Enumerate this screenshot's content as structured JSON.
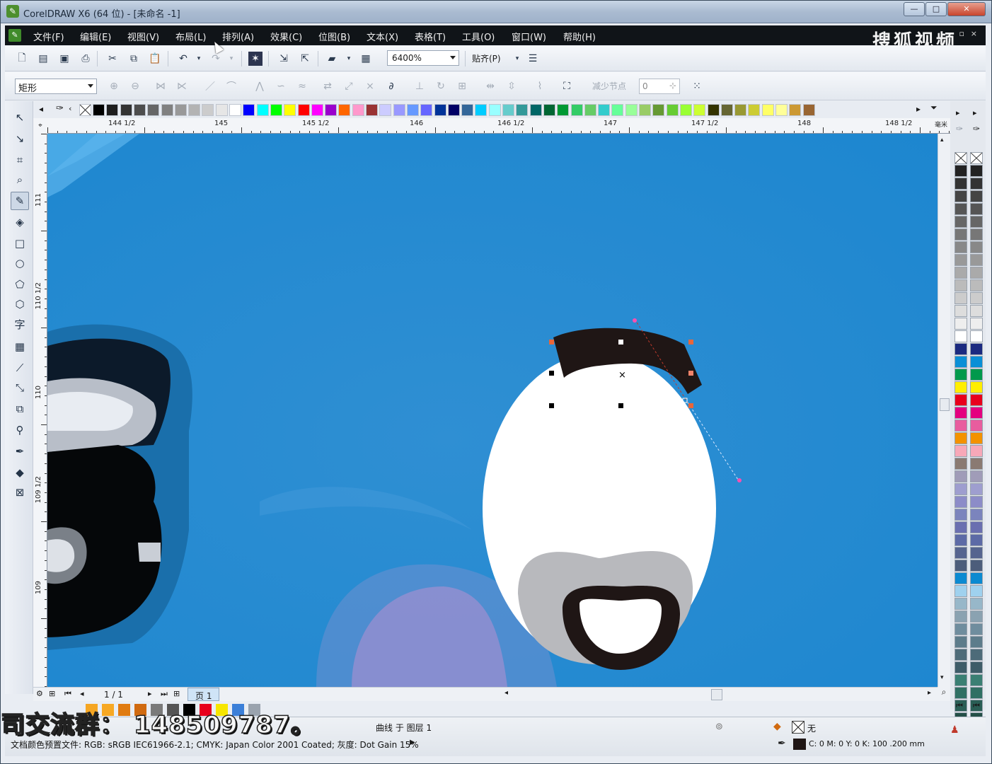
{
  "window": {
    "title": "CorelDRAW X6 (64 位) - [未命名 -1]",
    "minimize": "—",
    "maximize": "□",
    "close": "✕"
  },
  "menu": {
    "items": [
      "文件(F)",
      "编辑(E)",
      "视图(V)",
      "布局(L)",
      "排列(A)",
      "效果(C)",
      "位图(B)",
      "文本(X)",
      "表格(T)",
      "工具(O)",
      "窗口(W)",
      "帮助(H)"
    ],
    "watermark": "搜狐视频"
  },
  "standard_toolbar": {
    "zoom_value": "6400%",
    "snap_label": "贴齐(P)"
  },
  "property_bar": {
    "shape_select_value": "矩形",
    "reduce_nodes_label": "减少节点",
    "reduce_nodes_value": "0"
  },
  "palette_colors": [
    "#000000",
    "#1e1e1e",
    "#333333",
    "#4d4d4d",
    "#666666",
    "#808080",
    "#999999",
    "#b3b3b3",
    "#cccccc",
    "#e6e6e6",
    "#ffffff",
    "#0000ff",
    "#00ffff",
    "#00ff00",
    "#ffff00",
    "#ff0000",
    "#ff00ff",
    "#9900cc",
    "#ff6600",
    "#ff99cc",
    "#993333",
    "#ccccff",
    "#9999ff",
    "#6699ff",
    "#6666ff",
    "#003399",
    "#000066",
    "#336699",
    "#00ccff",
    "#99ffff",
    "#66cccc",
    "#339999",
    "#006666",
    "#006633",
    "#009933",
    "#33cc66",
    "#66cc66",
    "#33cccc",
    "#66ff99",
    "#99ff99",
    "#99cc66",
    "#669933",
    "#66cc33",
    "#99ff33",
    "#ccff33",
    "#333300",
    "#666633",
    "#999933",
    "#cccc33",
    "#ffff66",
    "#ffff99",
    "#cc9933",
    "#996633"
  ],
  "ruler": {
    "h_labels": [
      "144  1/2",
      "145",
      "145  1/2",
      "146",
      "146  1/2",
      "147",
      "147  1/2",
      "148",
      "148  1/2"
    ],
    "v_labels": [
      "111",
      "110  1/2",
      "110",
      "109  1/2",
      "109"
    ],
    "unit": "毫米"
  },
  "page_nav": {
    "counter": "1 / 1",
    "page_tab": "页 1"
  },
  "status": {
    "object_info": "曲线 于 图层 1",
    "fill_none": "无",
    "color_profile": "文档颜色预置文件: RGB: sRGB IEC61966-2.1; CMYK: Japan Color 2001 Coated; 灰度: Dot Gain 15%",
    "outline_info": "C: 0 M: 0 Y: 0 K: 100  .200 mm"
  },
  "overlay": {
    "promo_text": "司交流群： 148509787。"
  },
  "right_palette_colors": [
    "#222222",
    "#333333",
    "#444444",
    "#555555",
    "#666666",
    "#777777",
    "#888888",
    "#999999",
    "#aaaaaa",
    "#bbbbbb",
    "#cccccc",
    "#dddddd",
    "#eeeeee",
    "#ffffff",
    "#1b2a80",
    "#0a8fd6",
    "#00994c",
    "#ffee00",
    "#e8001c",
    "#e4007f",
    "#e85d9e",
    "#f39200",
    "#f7a8b8",
    "#8a7a72",
    "#a09cb8",
    "#9e9ecf",
    "#8c8cc8",
    "#7b84bd",
    "#6a6fb0",
    "#5c6aa6",
    "#55648f",
    "#4c5d7b",
    "#0b8ad1",
    "#9fd1ee",
    "#97b7c9",
    "#8aa2b1",
    "#6f8d9e",
    "#5d7c8b",
    "#4d6b79",
    "#3e5c68",
    "#3a7f73",
    "#2f6f63",
    "#2a5e55",
    "#244f47"
  ],
  "doc_palette_colors": [
    "#f5a623",
    "#f7a823",
    "#e07b10",
    "#d06a10",
    "#7a7a7a",
    "#555555",
    "#000000",
    "#e8001c",
    "#f7e600",
    "#3b7fd8",
    "#9aa3ae"
  ]
}
